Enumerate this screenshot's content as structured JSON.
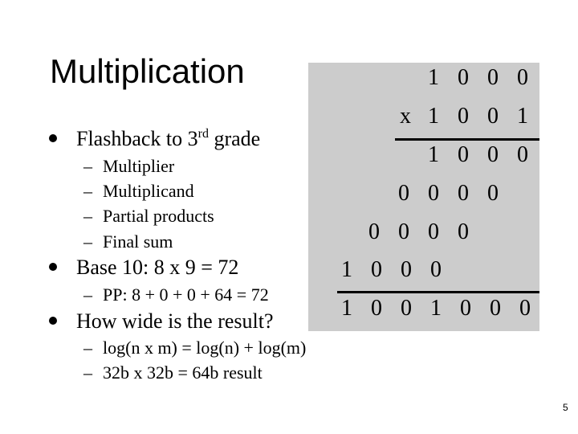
{
  "slide": {
    "title": "Multiplication",
    "page_number": "5",
    "bullets": [
      {
        "text_before_sup": "Flashback to 3",
        "sup": "rd",
        "text_after_sup": " grade",
        "sub": [
          "Multiplier",
          "Multiplicand",
          "Partial products",
          "Final sum"
        ]
      },
      {
        "text": "Base 10: 8 x 9 = 72",
        "sub": [
          "PP: 8 + 0 + 0 + 64 = 72"
        ]
      },
      {
        "text": "How wide is the result?",
        "sub": [
          "log(n x m) = log(n) + log(m)",
          "32b x 32b = 64b result"
        ]
      }
    ],
    "dash": "–",
    "multiplication": {
      "multiplicand": [
        "1",
        "0",
        "0",
        "0"
      ],
      "operator": "x",
      "multiplier": [
        "1",
        "0",
        "0",
        "1"
      ],
      "partial_products": [
        [
          "1",
          "0",
          "0",
          "0"
        ],
        [
          "0",
          "0",
          "0",
          "0"
        ],
        [
          "0",
          "0",
          "0",
          "0"
        ],
        [
          "1",
          "0",
          "0",
          "0"
        ]
      ],
      "result": [
        "1",
        "0",
        "0",
        "1",
        "0",
        "0",
        "0"
      ],
      "panel_color": "#cccccc"
    }
  }
}
